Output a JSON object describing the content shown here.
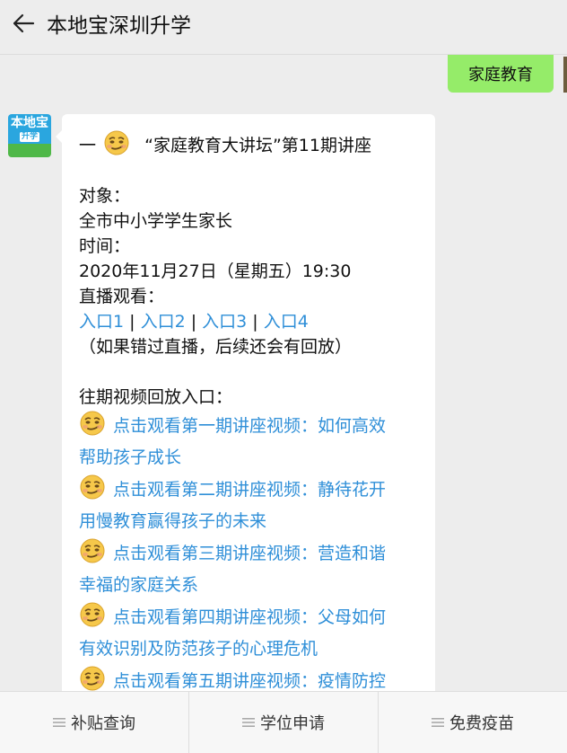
{
  "header": {
    "title": "本地宝深圳升学"
  },
  "my_message": {
    "text": "家庭教育"
  },
  "avatar": {
    "line1": "本地宝",
    "line2": "升学"
  },
  "message": {
    "heading_prefix": "一",
    "heading_text": "“家庭教育大讲坛”第11期讲座",
    "target_label": "对象：",
    "target_value": "全市中小学学生家长",
    "time_label": "时间：",
    "time_value": "2020年11月27日（星期五）19:30",
    "live_label": "直播观看：",
    "entries": [
      "入口1",
      "入口2",
      "入口3",
      "入口4"
    ],
    "separator": " | ",
    "replay_note": "（如果错过直播，后续还会有回放）",
    "past_label": "往期视频回放入口：",
    "videos": [
      {
        "line1": "点击观看第一期讲座视频：如何高效",
        "line2": "帮助孩子成长"
      },
      {
        "line1": "点击观看第二期讲座视频：静待花开",
        "line2": " 用慢教育赢得孩子的未来"
      },
      {
        "line1": "点击观看第三期讲座视频：营造和谐",
        "line2": "幸福的家庭关系"
      },
      {
        "line1": "点击观看第四期讲座视频：父母如何",
        "line2": "有效识别及防范孩子的心理危机"
      },
      {
        "line1": "点击观看第五期讲座视频：疫情防控",
        "line2": ""
      }
    ]
  },
  "tabs": [
    {
      "label": "补贴查询"
    },
    {
      "label": "学位申请"
    },
    {
      "label": "免费疫苗"
    }
  ],
  "colors": {
    "link": "#2f8fd8",
    "bubble_mine": "#95ec69",
    "brand": "#2aa6df"
  }
}
